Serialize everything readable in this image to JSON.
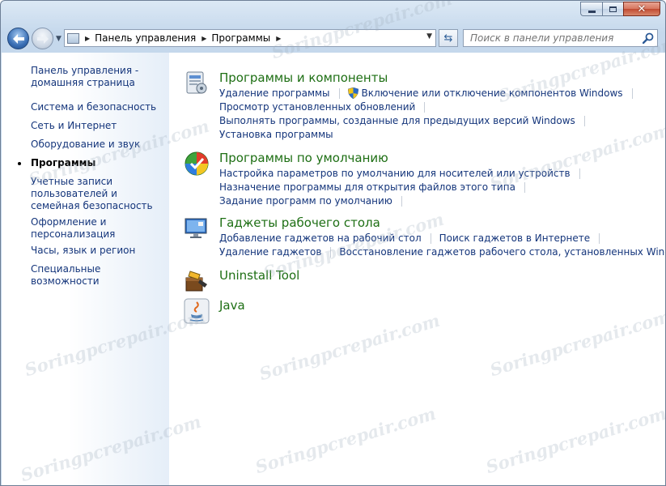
{
  "window": {
    "caption_buttons": {
      "minimize": "minimize",
      "maximize": "maximize",
      "close": "✕"
    }
  },
  "nav": {
    "breadcrumbs": [
      "Панель управления",
      "Программы"
    ]
  },
  "search": {
    "placeholder": "Поиск в панели управления"
  },
  "sidebar": {
    "items": [
      {
        "label": "Панель управления - домашняя страница"
      },
      {
        "label": "Система и безопасность"
      },
      {
        "label": "Сеть и Интернет"
      },
      {
        "label": "Оборудование и звук"
      },
      {
        "label": "Программы",
        "active": true
      },
      {
        "label": "Учетные записи пользователей и семейная безопасность"
      },
      {
        "label": "Оформление и персонализация"
      },
      {
        "label": "Часы, язык и регион"
      },
      {
        "label": "Специальные возможности"
      }
    ]
  },
  "categories": [
    {
      "title": "Программы и компоненты",
      "icon": "programs-features-icon",
      "tasks": [
        [
          "Удаление программы",
          "Включение или отключение компонентов Windows"
        ],
        [
          "Просмотр установленных обновлений"
        ],
        [
          "Выполнять программы, созданные для предыдущих версий Windows"
        ],
        [
          "Установка программы"
        ]
      ]
    },
    {
      "title": "Программы по умолчанию",
      "icon": "default-programs-icon",
      "tasks": [
        [
          "Настройка параметров по умолчанию для носителей или устройств"
        ],
        [
          "Назначение программы для открытия файлов этого типа"
        ],
        [
          "Задание программ по умолчанию"
        ]
      ]
    },
    {
      "title": "Гаджеты рабочего стола",
      "icon": "desktop-gadgets-icon",
      "tasks": [
        [
          "Добавление гаджетов на рабочий стол",
          "Поиск гаджетов в Интернете"
        ],
        [
          "Удаление гаджетов",
          "Восстановление гаджетов рабочего стола, установленных Windows"
        ]
      ]
    },
    {
      "title": "Uninstall Tool",
      "icon": "uninstall-tool-icon",
      "tasks": []
    },
    {
      "title": "Java",
      "icon": "java-icon",
      "tasks": []
    }
  ],
  "watermark": "Soringpcrepair.com",
  "colors": {
    "link": "#14357b",
    "category_title": "#1e6f14",
    "close_button": "#c14a31"
  }
}
